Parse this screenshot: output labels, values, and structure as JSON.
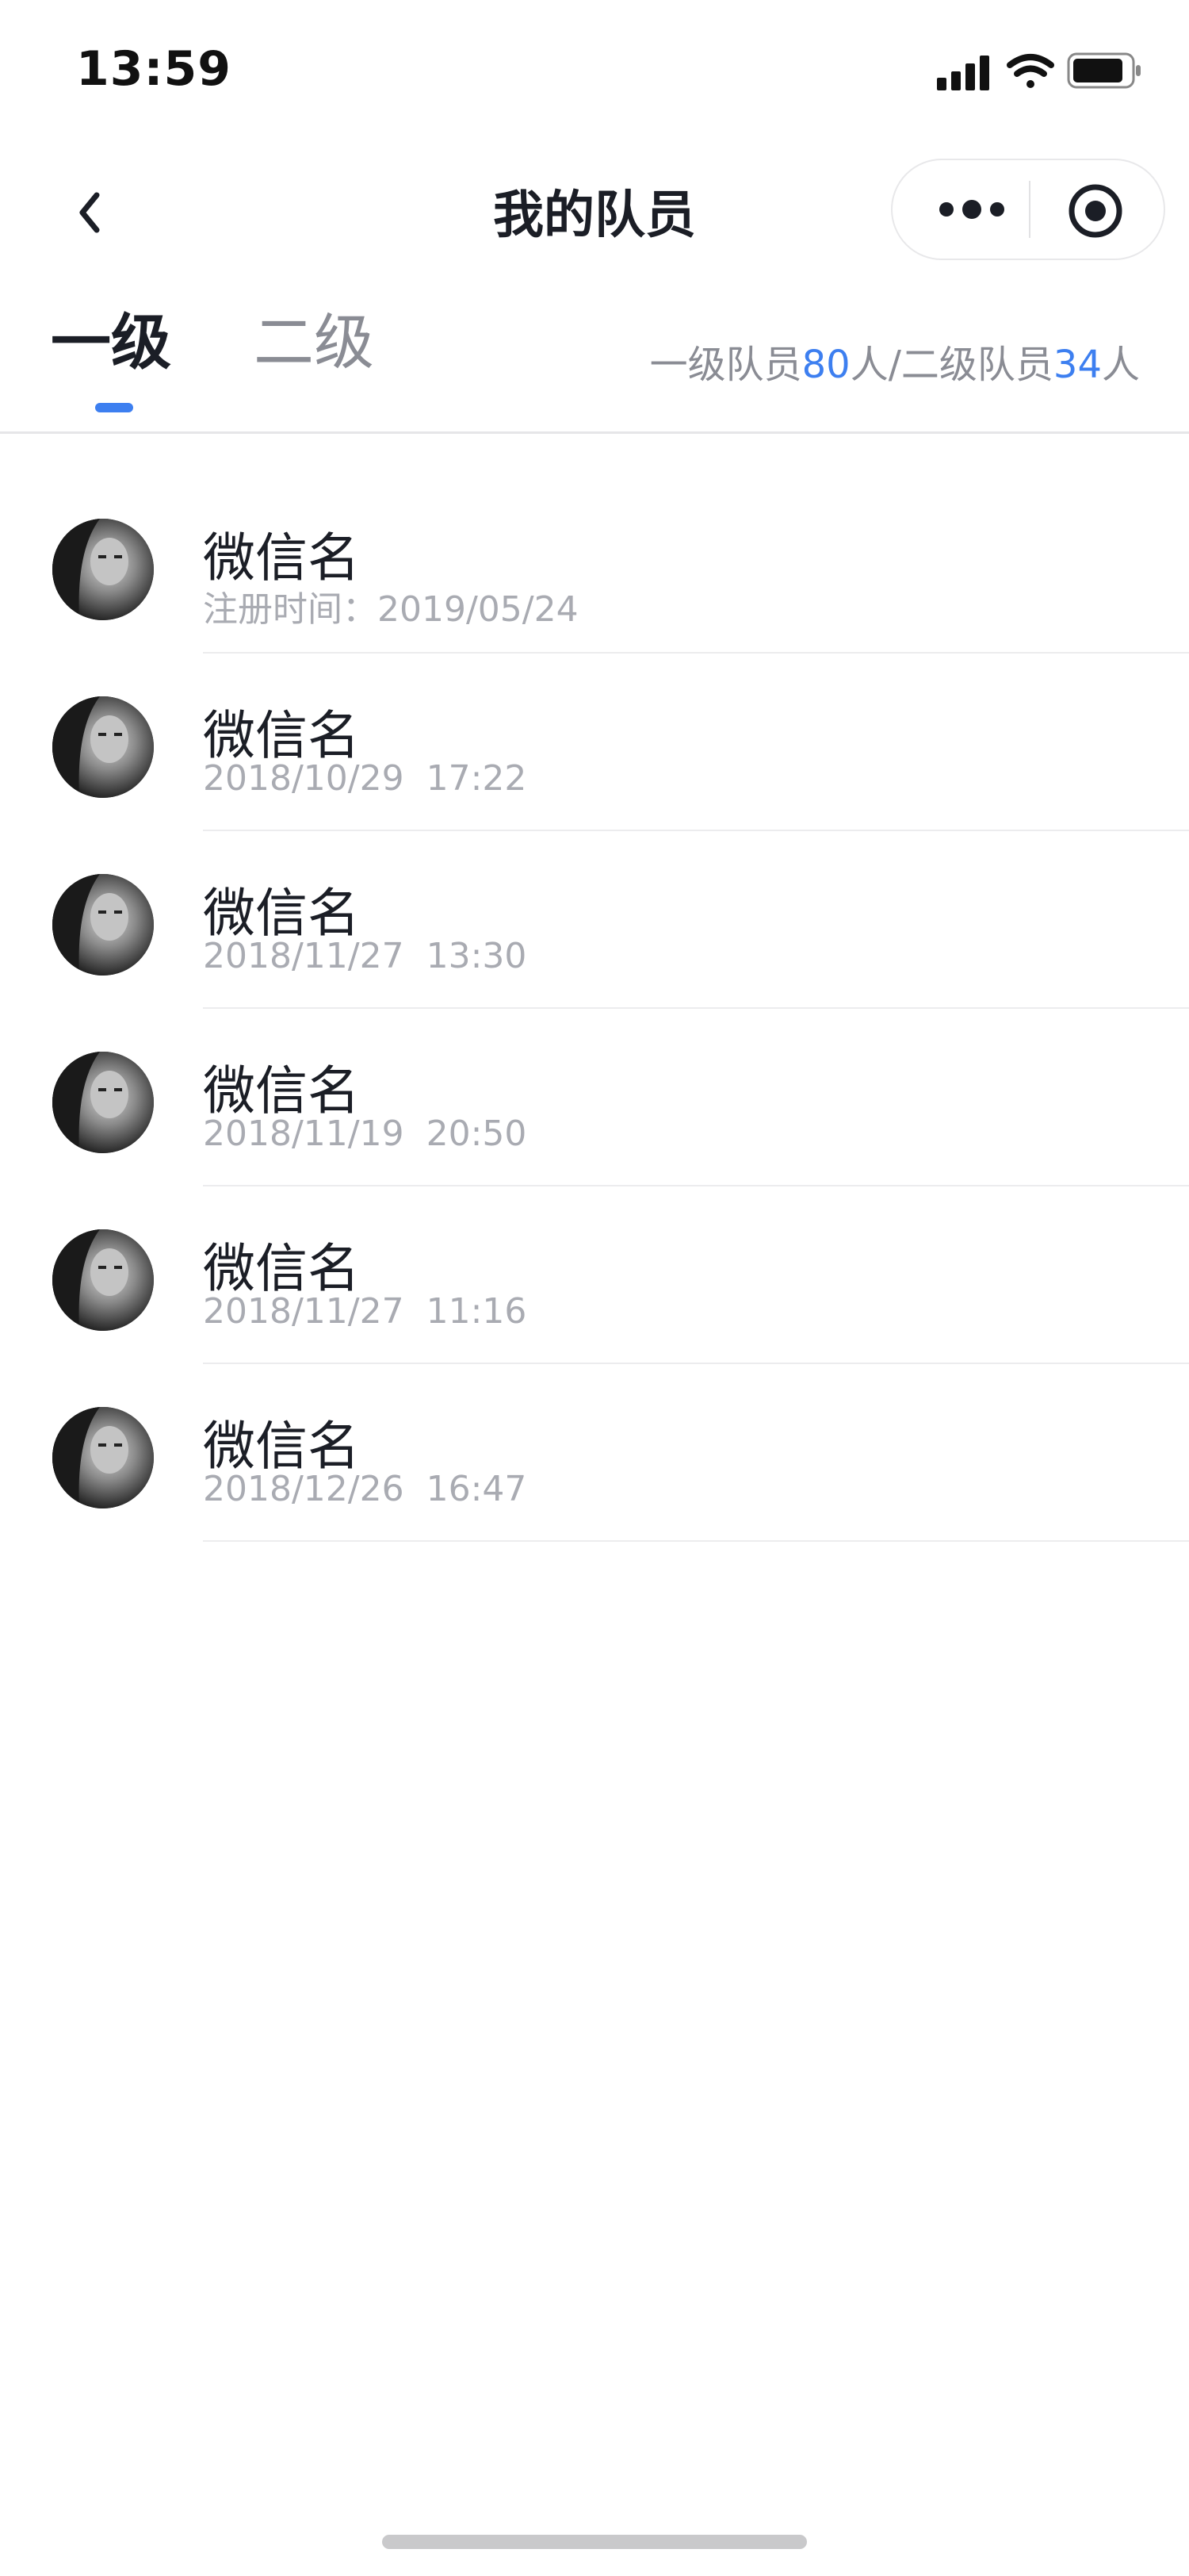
{
  "status_bar": {
    "time": "13:59",
    "icons": [
      "signal-icon",
      "wifi-icon",
      "battery-icon"
    ]
  },
  "nav": {
    "title": "我的队员",
    "back_icon": "chevron-left-icon",
    "more_icon": "more-dots-icon",
    "close_icon": "target-close-icon"
  },
  "tabs": {
    "items": [
      {
        "label": "一级",
        "active": true
      },
      {
        "label": "二级",
        "active": false
      }
    ],
    "stats": {
      "prefix1": "一级队员",
      "count1": "80",
      "unit1": "人",
      "sep": "/",
      "prefix2": "二级队员",
      "count2": "34",
      "unit2": "人"
    }
  },
  "colors": {
    "accent": "#3d7ff0",
    "text": "#1b1e26",
    "muted": "#a9abb2"
  },
  "members": [
    {
      "name": "微信名",
      "date": "注册时间：2019/05/24",
      "time": ""
    },
    {
      "name": "微信名",
      "date": "2018/10/29",
      "time": "17:22"
    },
    {
      "name": "微信名",
      "date": "2018/11/27",
      "time": "13:30"
    },
    {
      "name": "微信名",
      "date": "2018/11/19",
      "time": "20:50"
    },
    {
      "name": "微信名",
      "date": "2018/11/27",
      "time": "11:16"
    },
    {
      "name": "微信名",
      "date": "2018/12/26",
      "time": "16:47"
    }
  ]
}
